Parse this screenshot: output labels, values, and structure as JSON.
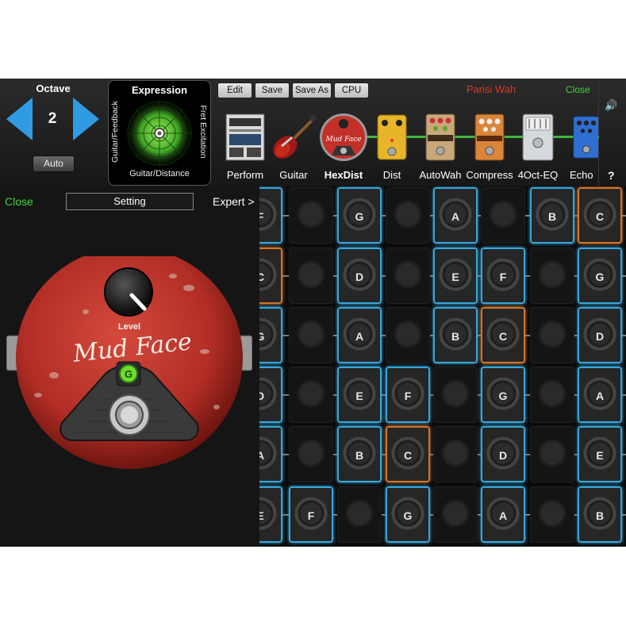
{
  "octave": {
    "label": "Octave",
    "value": "2",
    "auto_label": "Auto"
  },
  "expression": {
    "title": "Expression",
    "left_label": "Guitar/Feedback",
    "right_label": "Fret Excitation",
    "bottom_label": "Guitar/Distance"
  },
  "toolbar": {
    "edit": "Edit",
    "save": "Save",
    "save_as": "Save As",
    "cpu": "CPU"
  },
  "preset_name": "Parisi Wah",
  "close_top": "Close",
  "help": "?",
  "effects": [
    {
      "label": "Perform",
      "icon": "perform-screen-icon",
      "active": false
    },
    {
      "label": "Guitar",
      "icon": "guitar-icon",
      "active": false
    },
    {
      "label": "HexDist",
      "icon": "hexdist-pedal-icon",
      "active": true
    },
    {
      "label": "Dist",
      "icon": "dist-pedal-icon",
      "active": false
    },
    {
      "label": "AutoWah",
      "icon": "autowah-pedal-icon",
      "active": false
    },
    {
      "label": "Compress",
      "icon": "compress-pedal-icon",
      "active": false
    },
    {
      "label": "4Oct-EQ",
      "icon": "eq-pedal-icon",
      "active": false
    },
    {
      "label": "Echo",
      "icon": "echo-pedal-icon",
      "active": false
    }
  ],
  "left_panel": {
    "close": "Close",
    "setting": "Setting",
    "expert": "Expert >",
    "pedal_name": "Mud Face",
    "knob_label": "Level",
    "led_label": "G"
  },
  "fretboard": {
    "rows": [
      [
        "F",
        "",
        "G",
        "",
        "A",
        "",
        "B",
        "C"
      ],
      [
        "C",
        "",
        "D",
        "",
        "E",
        "F",
        "",
        "G"
      ],
      [
        "G",
        "",
        "A",
        "",
        "B",
        "C",
        "",
        "D"
      ],
      [
        "D",
        "",
        "E",
        "F",
        "",
        "G",
        "",
        "A"
      ],
      [
        "A",
        "",
        "B",
        "C",
        "",
        "D",
        "",
        "E"
      ],
      [
        "E",
        "F",
        "",
        "G",
        "",
        "A",
        "",
        "B"
      ]
    ],
    "root_cells": [
      [
        0,
        7
      ],
      [
        1,
        0
      ],
      [
        2,
        5
      ],
      [
        4,
        3
      ]
    ]
  },
  "colors": {
    "accent_blue": "#36a7da",
    "root_orange": "#d2762a",
    "close_green": "#3fd53a",
    "preset_red": "#d83a2a",
    "pedal_red": "#c0392b"
  }
}
